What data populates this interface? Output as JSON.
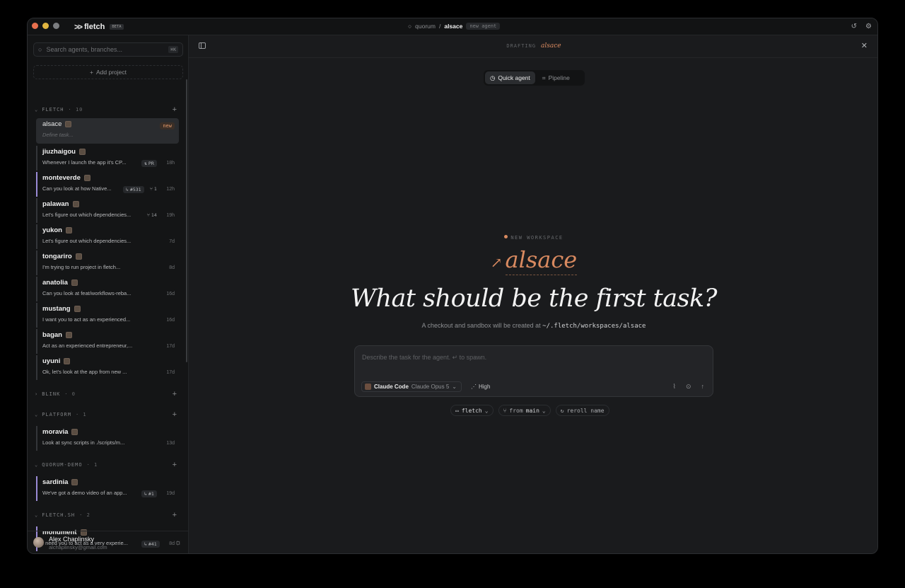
{
  "titlebar": {
    "app_name": "fletch",
    "beta": "BETA",
    "project": "quorum",
    "separator": "/",
    "current": "alsace",
    "status_pill": "new agent"
  },
  "sidebar": {
    "search_placeholder": "Search agents, branches...",
    "search_kbd": "⌘K",
    "add_project": "Add project",
    "groups": [
      {
        "name": "FLETCH",
        "count": "10"
      },
      {
        "name": "BLINK",
        "count": "0"
      },
      {
        "name": "PLATFORM",
        "count": "1"
      },
      {
        "name": "QUORUM-DEMO",
        "count": "1"
      },
      {
        "name": "FLETCH.SH",
        "count": "2"
      }
    ],
    "items": [
      {
        "name": "alsace",
        "desc": "Define task...",
        "tag": "new"
      },
      {
        "name": "jiuzhaigou",
        "desc": "Whenever I launch the app it's CP...",
        "meta": "PR",
        "time": "18h"
      },
      {
        "name": "monteverde",
        "desc": "Can you look at how Native...",
        "meta": "#531",
        "meta2": "1",
        "time": "12h"
      },
      {
        "name": "palawan",
        "desc": "Let's figure out which dependencies...",
        "meta2": "14",
        "time": "19h"
      },
      {
        "name": "yukon",
        "desc": "Let's figure out which dependencies...",
        "time": "7d"
      },
      {
        "name": "tongariro",
        "desc": "I'm trying to run project in fletch...",
        "time": "8d"
      },
      {
        "name": "anatolia",
        "desc": "Can you look at feat/workflows-reba...",
        "time": "16d"
      },
      {
        "name": "mustang",
        "desc": "I want you to act as an experienced...",
        "time": "16d"
      },
      {
        "name": "bagan",
        "desc": "Act as an experienced entrepreneur,...",
        "time": "17d"
      },
      {
        "name": "uyuni",
        "desc": "Ok, let's look at the app from new ...",
        "time": "17d"
      },
      {
        "name": "moravia",
        "desc": "Look at sync scripts in ./scripts/m...",
        "time": "13d"
      },
      {
        "name": "sardinia",
        "desc": "We've got a demo video of an app...",
        "meta": "#1",
        "time": "19d"
      },
      {
        "name": "monument",
        "desc": "I need you to act as a very experie...",
        "meta": "#41",
        "time": "8d"
      }
    ],
    "user": {
      "name": "Alex Chaplinsky",
      "email": "alchaplinsky@gmail.com"
    }
  },
  "main": {
    "drafting_label": "DRAFTING",
    "drafting_name": "alsace",
    "modes": [
      "Quick agent",
      "Pipeline"
    ],
    "new_workspace": "NEW WORKSPACE",
    "workspace_name": "alsace",
    "headline": "What should be the first task?",
    "sub_text": "A checkout and sandbox will be created at",
    "sub_path": "~/.fletch/workspaces/alsace",
    "composer": {
      "placeholder": "Describe the task for the agent. ↵ to spawn.",
      "agent": "Claude Code",
      "model": "Claude Opus 5",
      "effort": "High"
    },
    "chips": {
      "repo": "fletch",
      "from_label": "from",
      "branch": "main",
      "reroll": "reroll name"
    }
  },
  "colors": {
    "accent": "#d98a60",
    "active_bar": "#9b8bd6"
  }
}
